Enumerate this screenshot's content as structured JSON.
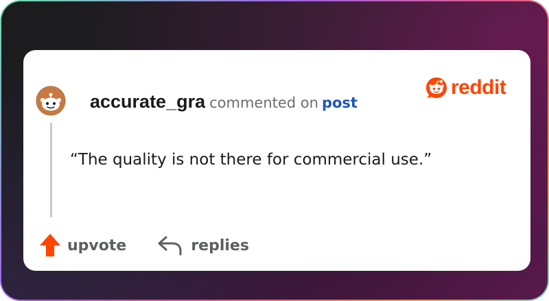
{
  "comment": {
    "username": "accurate_gra",
    "action_text": "commented on",
    "target_link": "post",
    "quote": "“The quality is not there for commercial use.”"
  },
  "brand": {
    "name": "reddit",
    "color": "#ff4500",
    "icon": "reddit-snoo-icon"
  },
  "actions": {
    "upvote_label": "upvote",
    "upvote_icon": "upvote-arrow-icon",
    "upvote_color": "#ff4500",
    "replies_label": "replies",
    "replies_icon": "reply-arrow-icon"
  },
  "colors": {
    "link": "#1d58b8",
    "secondary_text": "#6a6e72",
    "avatar": "#c87a45"
  }
}
